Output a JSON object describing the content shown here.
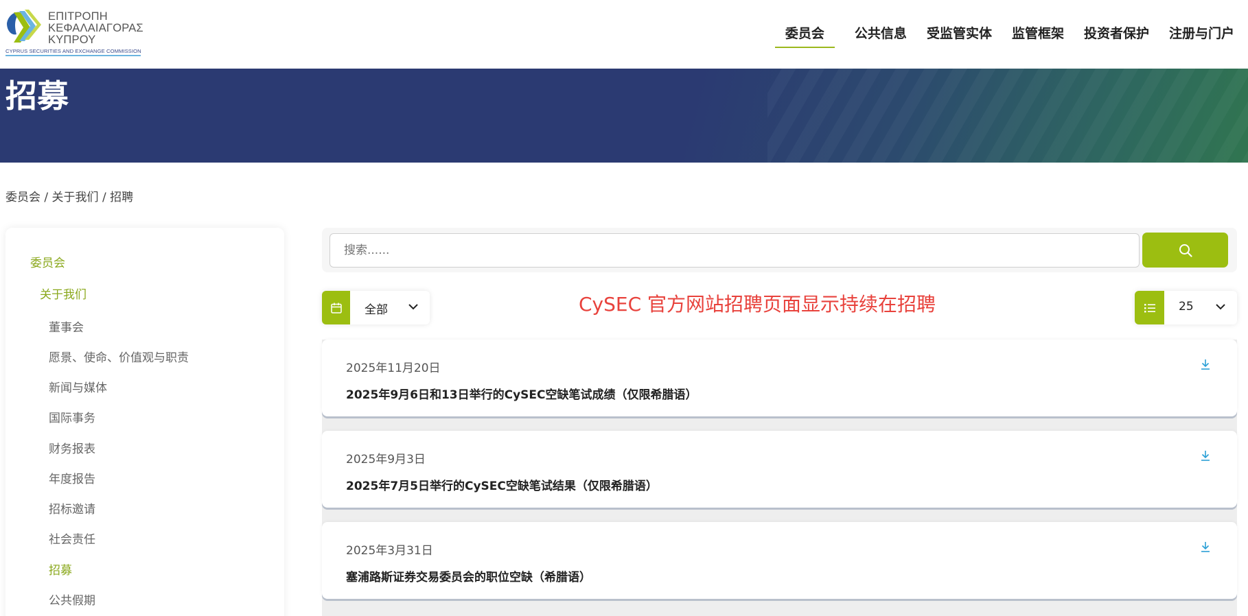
{
  "logo": {
    "line1": "ΕΠΙΤΡΟΠΗ",
    "line2": "ΚΕΦΑΛΑΙΑΓΟΡΑΣ",
    "line3": "ΚΥΠΡΟΥ",
    "subtitle": "CYPRUS SECURITIES AND EXCHANGE COMMISSION"
  },
  "nav": {
    "items": [
      {
        "label": "委员会",
        "active": true
      },
      {
        "label": "公共信息",
        "active": false
      },
      {
        "label": "受监管实体",
        "active": false
      },
      {
        "label": "监管框架",
        "active": false
      },
      {
        "label": "投资者保护",
        "active": false
      },
      {
        "label": "注册与门户",
        "active": false
      }
    ]
  },
  "hero": {
    "title": "招募"
  },
  "breadcrumb": "委员会 / 关于我们 / 招聘",
  "sidebar": {
    "items": [
      {
        "label": "委员会",
        "highlight": true
      },
      {
        "label": "关于我们",
        "highlight": true
      },
      {
        "label": "董事会",
        "highlight": false
      },
      {
        "label": "愿景、使命、价值观与职责",
        "highlight": false
      },
      {
        "label": "新闻与媒体",
        "highlight": false
      },
      {
        "label": "国际事务",
        "highlight": false
      },
      {
        "label": "财务报表",
        "highlight": false
      },
      {
        "label": "年度报告",
        "highlight": false
      },
      {
        "label": "招标邀请",
        "highlight": false
      },
      {
        "label": "社会责任",
        "highlight": false
      },
      {
        "label": "招募",
        "highlight": true
      },
      {
        "label": "公共假期",
        "highlight": false
      }
    ]
  },
  "search": {
    "placeholder": "搜索......"
  },
  "filter": {
    "year_label": "全部"
  },
  "notice": "CySEC 官方网站招聘页面显示持续在招聘",
  "perpage": {
    "value": "25"
  },
  "documents": [
    {
      "date": "2025年11月20日",
      "title": "2025年9月6日和13日举行的CySEC空缺笔试成绩（仅限希腊语）"
    },
    {
      "date": "2025年9月3日",
      "title": "2025年7月5日举行的CySEC空缺笔试结果（仅限希腊语）"
    },
    {
      "date": "2025年3月31日",
      "title": "塞浦路斯证券交易委员会的职位空缺（希腊语）"
    }
  ],
  "colors": {
    "accent": "#9cbe11",
    "hero": "#2b3a72",
    "notice": "#e8423c",
    "download": "#2a9fd6"
  },
  "icons": {
    "search": "search-icon",
    "calendar": "calendar-icon",
    "list": "list-icon",
    "chevron": "chevron-down-icon",
    "download": "download-icon"
  }
}
